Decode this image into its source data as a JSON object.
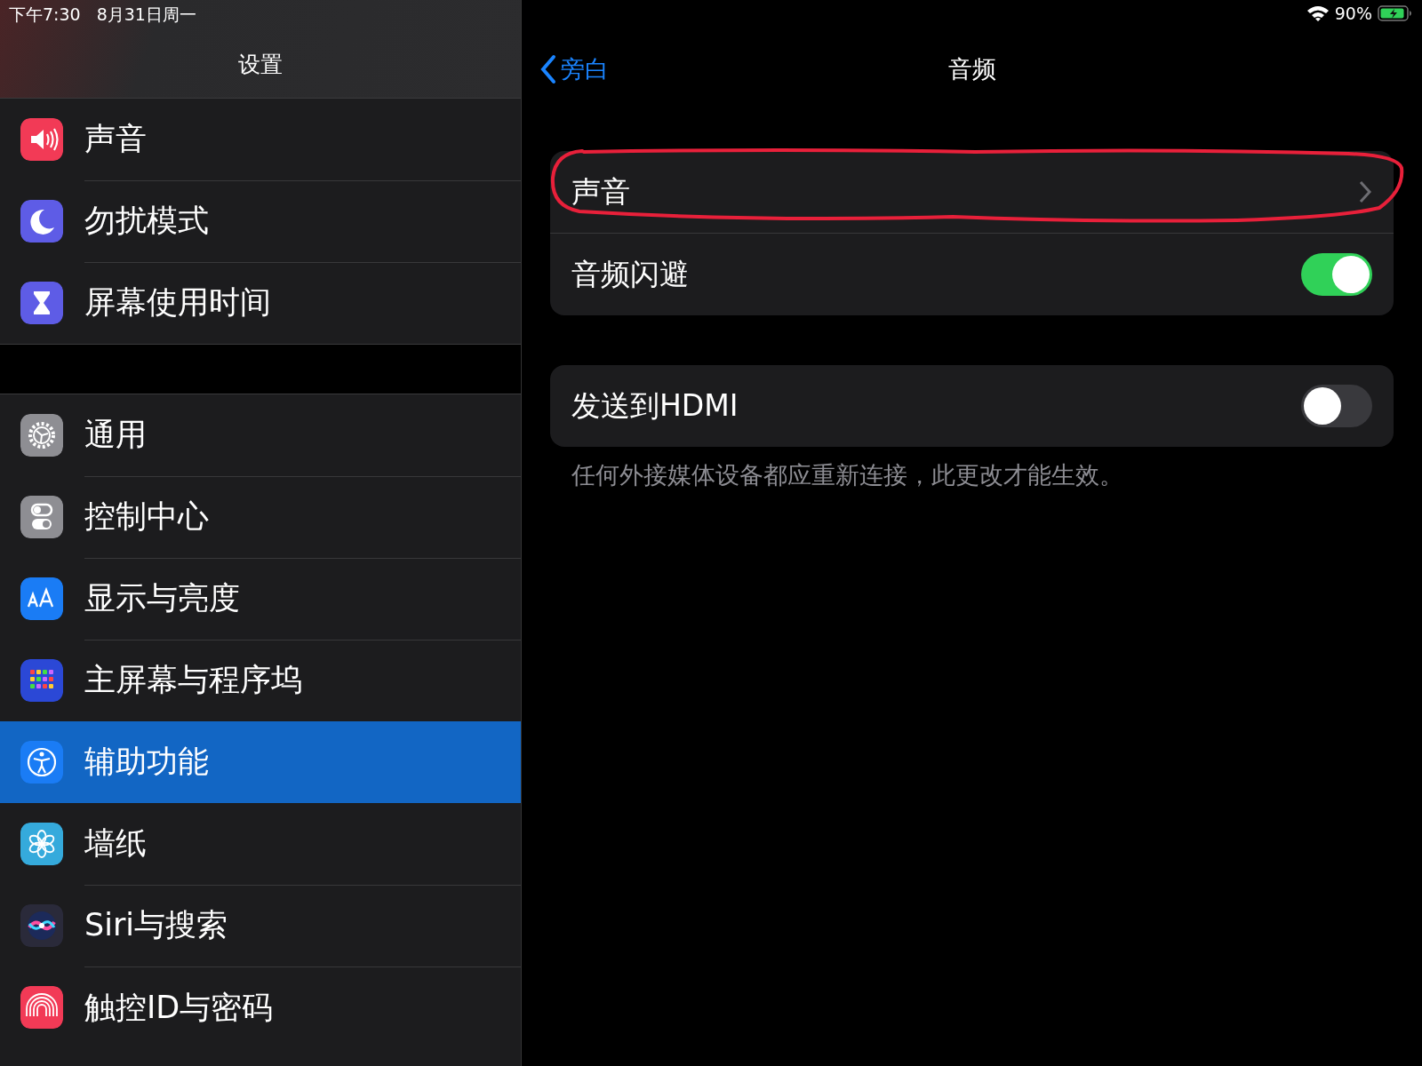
{
  "status_bar": {
    "time": "下午7:30",
    "date": "8月31日周一",
    "battery_percent": "90%"
  },
  "sidebar": {
    "title": "设置",
    "groups": [
      [
        {
          "label": "声音",
          "color": "#f23a56",
          "selected": false
        },
        {
          "label": "勿扰模式",
          "color": "#5e5ce6",
          "selected": false
        },
        {
          "label": "屏幕使用时间",
          "color": "#5e5ce6",
          "selected": false
        }
      ],
      [
        {
          "label": "通用",
          "color": "#8e8e93",
          "selected": false
        },
        {
          "label": "控制中心",
          "color": "#8e8e93",
          "selected": false
        },
        {
          "label": "显示与亮度",
          "color": "#1a7cf5",
          "selected": false
        },
        {
          "label": "主屏幕与程序坞",
          "color": "#2b48d6",
          "selected": false
        },
        {
          "label": "辅助功能",
          "color": "#1a7cf5",
          "selected": true
        },
        {
          "label": "墙纸",
          "color": "#35aadc",
          "selected": false
        },
        {
          "label": "Siri与搜索",
          "color": "#2a2a3a",
          "selected": false
        },
        {
          "label": "触控ID与密码",
          "color": "#f23a56",
          "selected": false
        }
      ]
    ]
  },
  "detail": {
    "back": "旁白",
    "title": "音频",
    "groups": [
      {
        "rows": [
          {
            "kind": "link",
            "label": "声音"
          },
          {
            "kind": "toggle",
            "label": "音频闪避",
            "on": true
          }
        ]
      },
      {
        "rows": [
          {
            "kind": "toggle",
            "label": "发送到HDMI",
            "on": false
          }
        ],
        "footer": "任何外接媒体设备都应重新连接，此更改才能生效。"
      }
    ]
  }
}
